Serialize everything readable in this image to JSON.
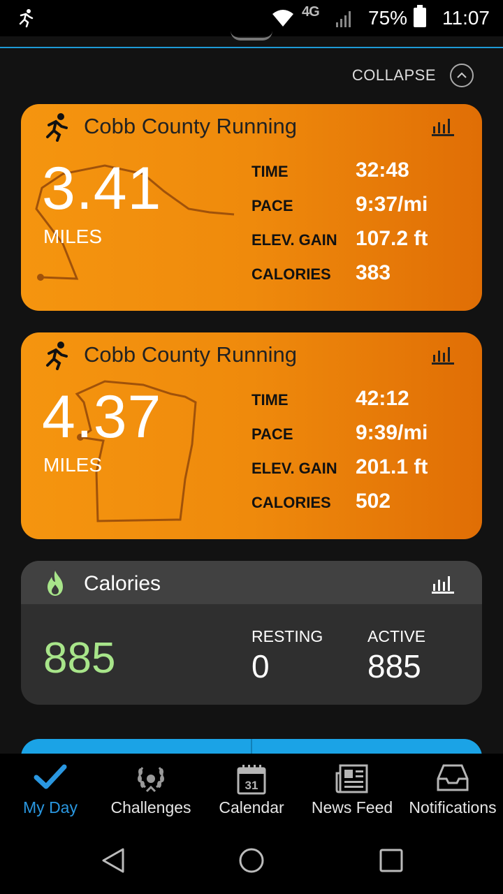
{
  "status_bar": {
    "network": "4G",
    "battery": "75%",
    "time": "11:07"
  },
  "collapse": {
    "label": "COLLAPSE"
  },
  "activities": [
    {
      "title": "Cobb County Running",
      "distance": "3.41",
      "unit": "MILES",
      "stats": [
        {
          "label": "TIME",
          "value": "32:48"
        },
        {
          "label": "PACE",
          "value": "9:37/mi"
        },
        {
          "label": "ELEV. GAIN",
          "value": "107.2 ft"
        },
        {
          "label": "CALORIES",
          "value": "383"
        }
      ]
    },
    {
      "title": "Cobb County Running",
      "distance": "4.37",
      "unit": "MILES",
      "stats": [
        {
          "label": "TIME",
          "value": "42:12"
        },
        {
          "label": "PACE",
          "value": "9:39/mi"
        },
        {
          "label": "ELEV. GAIN",
          "value": "201.1 ft"
        },
        {
          "label": "CALORIES",
          "value": "502"
        }
      ]
    }
  ],
  "calories": {
    "title": "Calories",
    "total": "885",
    "resting_label": "RESTING",
    "resting_value": "0",
    "active_label": "ACTIVE",
    "active_value": "885"
  },
  "bottom_nav": [
    {
      "label": "My Day",
      "icon": "checkmark-icon",
      "active": true
    },
    {
      "label": "Challenges",
      "icon": "laurel-icon",
      "active": false
    },
    {
      "label": "Calendar",
      "icon": "calendar-icon",
      "calendar_day": "31",
      "active": false
    },
    {
      "label": "News Feed",
      "icon": "newspaper-icon",
      "active": false
    },
    {
      "label": "Notifications",
      "icon": "inbox-icon",
      "active": false
    }
  ],
  "colors": {
    "activity_card": "#f08a0c",
    "calorie_accent": "#a8e58a",
    "active_nav": "#2a97e0",
    "divider": "#1e9ad6"
  }
}
